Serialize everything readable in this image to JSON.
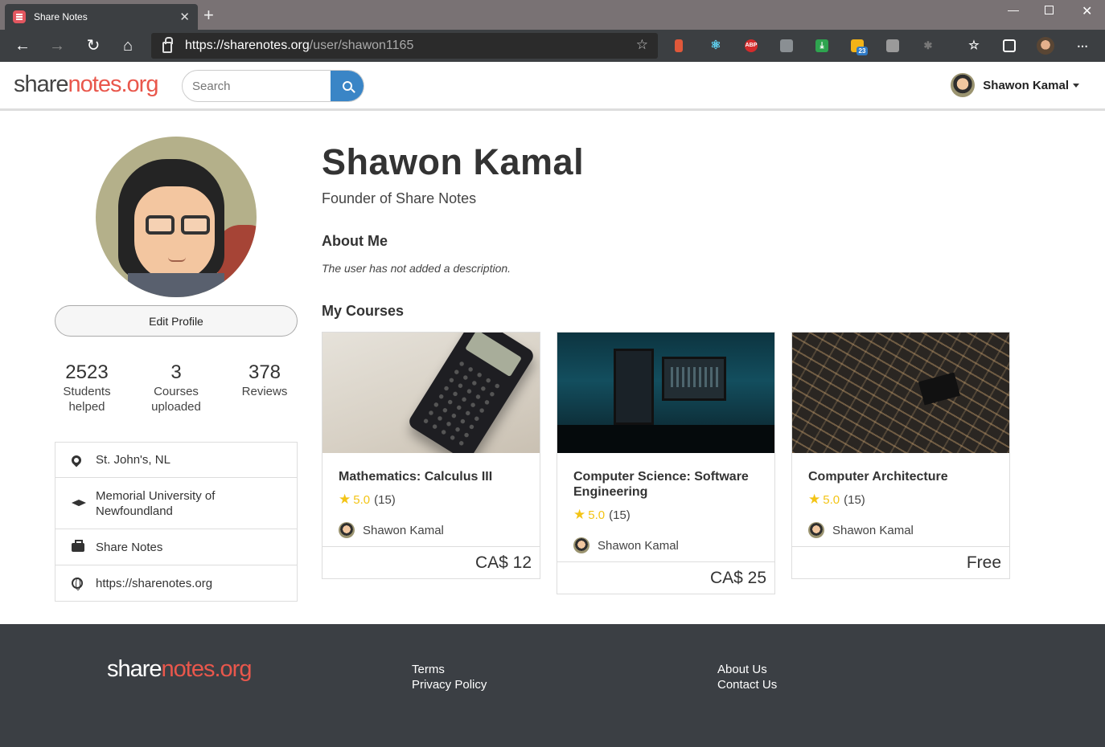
{
  "browser": {
    "tab_title": "Share Notes",
    "url_host": "https://sharenotes.org",
    "url_path": "/user/shawon1165",
    "ext_badge": "23"
  },
  "header": {
    "logo_a": "share",
    "logo_b": "notes.org",
    "search_placeholder": "Search",
    "user_name": "Shawon Kamal"
  },
  "profile": {
    "edit_label": "Edit Profile",
    "stats": [
      {
        "num": "2523",
        "label1": "Students",
        "label2": "helped"
      },
      {
        "num": "3",
        "label1": "Courses",
        "label2": "uploaded"
      },
      {
        "num": "378",
        "label1": "Reviews",
        "label2": ""
      }
    ],
    "info": [
      {
        "icon": "map-pin-icon",
        "l1": "St. John's, NL",
        "l2": ""
      },
      {
        "icon": "graduation-cap-icon",
        "l1": "Memorial University of",
        "l2": "Newfoundland"
      },
      {
        "icon": "briefcase-icon",
        "l1": "Share Notes",
        "l2": ""
      },
      {
        "icon": "globe-icon",
        "l1": "https://sharenotes.org",
        "l2": ""
      }
    ]
  },
  "main": {
    "name": "Shawon Kamal",
    "title": "Founder of Share Notes",
    "about_heading": "About Me",
    "about_text": "The user has not added a description.",
    "courses_heading": "My Courses",
    "courses": [
      {
        "title": "Mathematics: Calculus III",
        "rating": "5.0",
        "count": "(15)",
        "author": "Shawon Kamal",
        "price": "CA$ 12"
      },
      {
        "title": "Computer Science: Software Engineering",
        "rating": "5.0",
        "count": "(15)",
        "author": "Shawon Kamal",
        "price": "CA$ 25"
      },
      {
        "title": "Computer Architecture",
        "rating": "5.0",
        "count": "(15)",
        "author": "Shawon Kamal",
        "price": "Free"
      }
    ]
  },
  "footer": {
    "logo_a": "share",
    "logo_b": "notes.org",
    "links_col1": [
      "Terms",
      "Privacy Policy"
    ],
    "links_col2": [
      "About Us",
      "Contact Us"
    ]
  },
  "colors": {
    "accent": "#e9574c",
    "search_btn": "#3a85c6",
    "star": "#f3c415",
    "footer_bg": "#3b3f44"
  }
}
